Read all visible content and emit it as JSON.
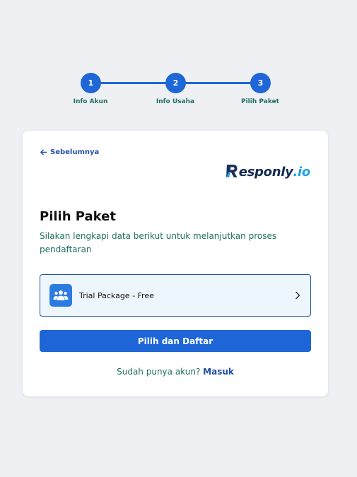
{
  "stepper": {
    "steps": [
      {
        "number": "1",
        "label": "Info Akun"
      },
      {
        "number": "2",
        "label": "Info Usaha"
      },
      {
        "number": "3",
        "label": "Pilih Paket"
      }
    ]
  },
  "card": {
    "back_label": "Sebelumnya",
    "logo": {
      "main": "esponly",
      "tld": ".io",
      "icon": "responly-r-logo"
    },
    "title": "Pilih Paket",
    "subtitle": "Silakan lengkapi data berikut untuk melanjutkan proses pendaftaran",
    "package": {
      "label": "Trial Package - Free",
      "icon": "users-group-icon"
    },
    "submit_label": "Pilih dan Daftar",
    "login_prompt": "Sudah punya akun?",
    "login_link": "Masuk"
  },
  "colors": {
    "primary": "#1e66d8",
    "accent_text": "#1f6f62",
    "background": "#eef0f4"
  }
}
